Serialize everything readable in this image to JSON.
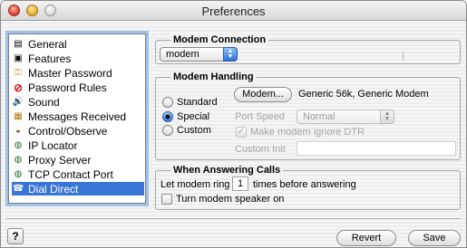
{
  "window": {
    "title": "Preferences"
  },
  "sidebar": {
    "items": [
      {
        "label": "General",
        "icon": "general-icon",
        "glyph": "▤"
      },
      {
        "label": "Features",
        "icon": "features-icon",
        "glyph": "▣"
      },
      {
        "label": "Master Password",
        "icon": "key-icon",
        "glyph": "⚿"
      },
      {
        "label": "Password Rules",
        "icon": "no-entry-icon",
        "glyph": "⊘"
      },
      {
        "label": "Sound",
        "icon": "speaker-icon",
        "glyph": "🔊"
      },
      {
        "label": "Messages Received",
        "icon": "messages-icon",
        "glyph": "▦"
      },
      {
        "label": "Control/Observe",
        "icon": "control-icon",
        "glyph": "◒"
      },
      {
        "label": "IP Locator",
        "icon": "globe-icon",
        "glyph": "◍"
      },
      {
        "label": "Proxy Server",
        "icon": "globe-icon",
        "glyph": "◍"
      },
      {
        "label": "TCP Contact Port",
        "icon": "globe-icon",
        "glyph": "◍"
      },
      {
        "label": "Dial Direct",
        "icon": "telephone-icon",
        "glyph": "☎"
      }
    ],
    "selected": "Dial Direct"
  },
  "modem_connection": {
    "title": "Modem Connection",
    "value": "modem"
  },
  "modem_handling": {
    "title": "Modem Handling",
    "options": [
      "Standard",
      "Special",
      "Custom"
    ],
    "selected": "Special",
    "modem_button": "Modem...",
    "modem_name": "Generic 56k, Generic Modem",
    "port_speed_label": "Port Speed",
    "port_speed_value": "Normal",
    "ignore_dtr_label": "Make modem ignore DTR",
    "ignore_dtr_checked": true,
    "custom_init_label": "Custom Init",
    "custom_init_value": ""
  },
  "answering": {
    "title": "When Answering Calls",
    "ring_prefix": "Let modem ring",
    "ring_count": "1",
    "ring_suffix": "times before answering",
    "speaker_label": "Turn modem speaker on",
    "speaker_checked": false
  },
  "footer": {
    "help_label": "?",
    "revert_label": "Revert",
    "save_label": "Save"
  },
  "colors": {
    "selection": "#3875d7",
    "accent": "#2f71d3"
  }
}
